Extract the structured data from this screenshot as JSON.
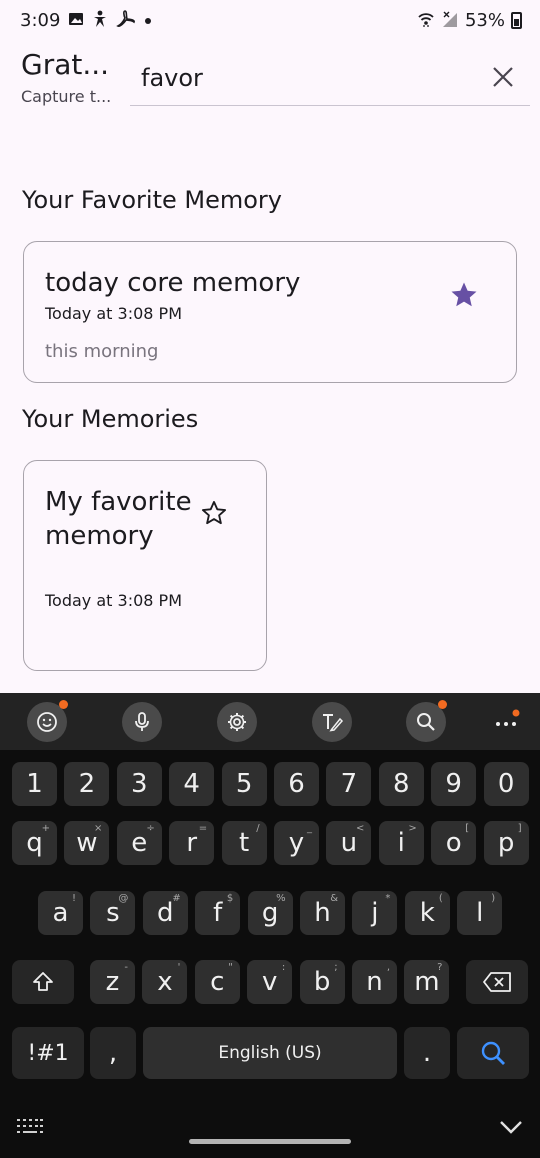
{
  "status": {
    "time": "3:09",
    "battery": "53%",
    "icons": [
      "gallery-icon",
      "accessibility-icon",
      "pdf-icon",
      "dot-icon",
      "wifi-icon",
      "signal-icon",
      "battery-icon"
    ]
  },
  "app": {
    "title": "Grat...",
    "subtitle": "Capture t...",
    "search_value": "favor"
  },
  "favorites": {
    "section_title": "Your Favorite Memory",
    "card": {
      "title": "today core memory",
      "time": "Today at 3:08 PM",
      "body": "this morning",
      "starred": true
    }
  },
  "memories": {
    "section_title": "Your Memories",
    "card": {
      "title": "My favorite memory",
      "time": "Today at 3:08 PM",
      "starred": false
    }
  },
  "colors": {
    "accent": "#6750a4",
    "background": "#fdf7fd",
    "keyboard_bg": "#0d0d0d",
    "key_bg": "#2f2f2f",
    "notify_dot": "#f26b21",
    "search_accent": "#3e91ff"
  },
  "keyboard": {
    "toolbar": [
      "emoji-icon",
      "mic-icon",
      "settings-icon",
      "handwriting-icon",
      "search-icon",
      "more-icon"
    ],
    "number_row": [
      "1",
      "2",
      "3",
      "4",
      "5",
      "6",
      "7",
      "8",
      "9",
      "0"
    ],
    "row1": [
      {
        "k": "q",
        "h": "+"
      },
      {
        "k": "w",
        "h": "×"
      },
      {
        "k": "e",
        "h": "÷"
      },
      {
        "k": "r",
        "h": "="
      },
      {
        "k": "t",
        "h": "/"
      },
      {
        "k": "y",
        "h": "_"
      },
      {
        "k": "u",
        "h": "<"
      },
      {
        "k": "i",
        "h": ">"
      },
      {
        "k": "o",
        "h": "["
      },
      {
        "k": "p",
        "h": "]"
      }
    ],
    "row2": [
      {
        "k": "a",
        "h": "!"
      },
      {
        "k": "s",
        "h": "@"
      },
      {
        "k": "d",
        "h": "#"
      },
      {
        "k": "f",
        "h": "$"
      },
      {
        "k": "g",
        "h": "%"
      },
      {
        "k": "h",
        "h": "&"
      },
      {
        "k": "j",
        "h": "*"
      },
      {
        "k": "k",
        "h": "("
      },
      {
        "k": "l",
        "h": ")"
      }
    ],
    "row3": [
      {
        "k": "z",
        "h": "-"
      },
      {
        "k": "x",
        "h": "'"
      },
      {
        "k": "c",
        "h": "\""
      },
      {
        "k": "v",
        "h": ":"
      },
      {
        "k": "b",
        "h": ";"
      },
      {
        "k": "n",
        "h": ","
      },
      {
        "k": "m",
        "h": "?"
      }
    ],
    "symbols_label": "!#1",
    "comma_label": ",",
    "space_label": "English (US)",
    "period_label": "."
  }
}
